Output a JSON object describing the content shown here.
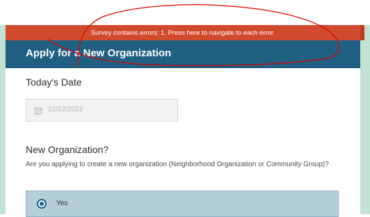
{
  "banner": {
    "error_text": "Survey contains errors: 1. Press here to navigate to each error."
  },
  "header": {
    "title": "Apply for a New Organization"
  },
  "fields": {
    "date": {
      "label": "Today's Date",
      "value": "12/22/2022",
      "icon": "calendar-icon"
    },
    "new_org": {
      "label": "New Organization?",
      "description": "Are you applying to create a new organization (Neighborhood Organization or Community Group)?",
      "options": [
        {
          "label": "Yes",
          "selected": true
        }
      ]
    }
  },
  "colors": {
    "error_red": "#d14a2c",
    "header_blue": "#1e5f82",
    "option_bg": "#b5cfd9",
    "annotation_red": "#e00000",
    "side_green": "#c4e2d3"
  }
}
